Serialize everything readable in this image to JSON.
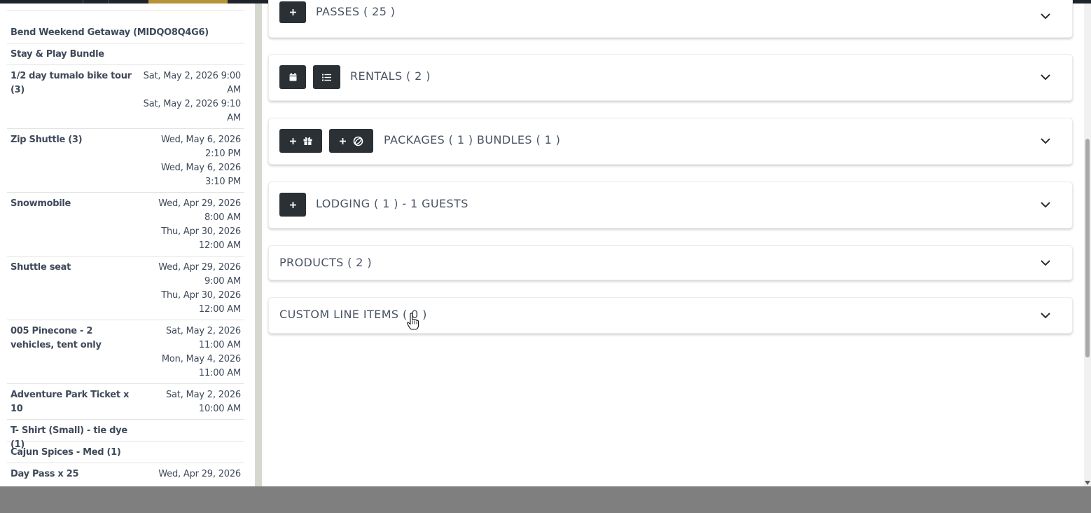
{
  "sidebar": {
    "items": [
      {
        "name": "Bend Weekend Getaway (MIDQO8Q4G6)",
        "dates": []
      },
      {
        "name": "Stay & Play Bundle",
        "dates": []
      },
      {
        "name": "1/2 day tumalo bike tour (3)",
        "dates": [
          "Sat, May 2, 2026 9:00",
          "AM",
          "Sat, May 2, 2026 9:10",
          "AM"
        ]
      },
      {
        "name": "Zip Shuttle (3)",
        "dates": [
          "Wed, May 6, 2026",
          "2:10 PM",
          "Wed, May 6, 2026",
          "3:10 PM"
        ]
      },
      {
        "name": "Snowmobile",
        "dates": [
          "Wed, Apr 29, 2026",
          "8:00 AM",
          "Thu, Apr 30, 2026",
          "12:00 AM"
        ]
      },
      {
        "name": "Shuttle seat",
        "dates": [
          "Wed, Apr 29, 2026",
          "9:00 AM",
          "Thu, Apr 30, 2026",
          "12:00 AM"
        ]
      },
      {
        "name": "005 Pinecone - 2 vehicles, tent only",
        "dates": [
          "Sat, May 2, 2026",
          "11:00 AM",
          "Mon, May 4, 2026",
          "11:00 AM"
        ]
      },
      {
        "name": "Adventure Park Ticket x 10",
        "dates": [
          "Sat, May 2, 2026",
          "10:00 AM"
        ]
      },
      {
        "name": "T- Shirt (Small) - tie dye (1)",
        "dates": []
      },
      {
        "name": "Cajun Spices - Med (1)",
        "dates": []
      },
      {
        "name": "Day Pass x 25",
        "dates": [
          "Wed, Apr 29, 2026"
        ]
      }
    ]
  },
  "sections": {
    "passes": {
      "title": "PASSES ( 25 )",
      "add_icon": "plus-icon"
    },
    "rentals": {
      "title": "RENTALS ( 2 )",
      "icons": [
        "calendar-icon",
        "list-icon"
      ]
    },
    "packages": {
      "title": "PACKAGES ( 1 ) BUNDLES ( 1 )",
      "icons": [
        "plus-icon",
        "gift-icon",
        "plus-icon",
        "bundle-icon"
      ]
    },
    "lodging": {
      "title": "LODGING ( 1 ) - 1 GUESTS",
      "add_icon": "plus-icon"
    },
    "products": {
      "title": "PRODUCTS ( 2 )"
    },
    "custom": {
      "title": "CUSTOM LINE ITEMS ( 0 )"
    }
  },
  "colors": {
    "button_bg": "#2b3035",
    "title_text": "#4a5463",
    "sidebar_text": "#3f4a5a",
    "topbar_accent": "#b8923a"
  }
}
